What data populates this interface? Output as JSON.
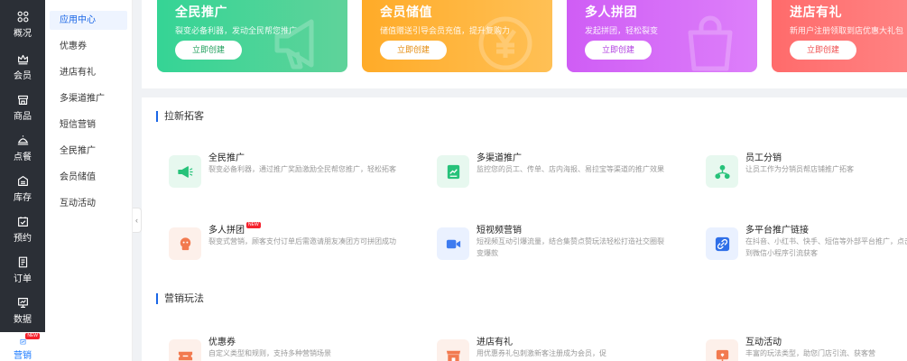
{
  "nav": {
    "items": [
      {
        "label": "概况",
        "icon": "grid-icon"
      },
      {
        "label": "会员",
        "icon": "crown-icon"
      },
      {
        "label": "商品",
        "icon": "shop-icon"
      },
      {
        "label": "点餐",
        "icon": "dish-icon"
      },
      {
        "label": "库存",
        "icon": "inventory-icon"
      },
      {
        "label": "预约",
        "icon": "calendar-check-icon"
      },
      {
        "label": "订单",
        "icon": "order-icon"
      },
      {
        "label": "数据",
        "icon": "data-icon"
      },
      {
        "label": "营销",
        "icon": "marketing-icon",
        "badge": "NEW"
      }
    ]
  },
  "submenu": {
    "items": [
      "应用中心",
      "优惠券",
      "进店有礼",
      "多渠道推广",
      "短信营销",
      "全民推广",
      "会员储值",
      "互动活动"
    ],
    "active": "应用中心"
  },
  "collapse_glyph": "‹",
  "banners": [
    {
      "title": "全民推广",
      "desc": "裂变必备利器，发动全民帮您推广",
      "button": "立即创建",
      "color": "#35d495"
    },
    {
      "title": "会员储值",
      "desc": "储值赠送引导会员充值，提升复购力",
      "button": "立即创建",
      "color": "#ffab28"
    },
    {
      "title": "多人拼团",
      "desc": "发起拼团，轻松裂变",
      "button": "立即创建",
      "color": "#cf5df5"
    },
    {
      "title": "进店有礼",
      "desc": "新用户注册领取到店优惠大礼包",
      "button": "立即创建",
      "color": "#ff6b6b"
    }
  ],
  "sections": [
    {
      "title": "拉新拓客",
      "cards": [
        {
          "title": "全民推广",
          "desc": "裂变必备利器，通过推广奖励激励全民帮您推广，轻松拓客",
          "icon": "megaphone-icon",
          "bg": "#e7f8ef",
          "fg": "#27c27a"
        },
        {
          "title": "多渠道推广",
          "desc": "监控您的员工、传单、店内海报、易拉宝等渠道的推广效果",
          "icon": "chart-board-icon",
          "bg": "#e7f8ef",
          "fg": "#27c27a"
        },
        {
          "title": "员工分销",
          "desc": "让员工作为分销员帮店铺推广拓客",
          "icon": "network-icon",
          "bg": "#e7f8ef",
          "fg": "#27c27a"
        },
        {
          "title": "多人拼团",
          "badge": "NEW",
          "desc": "裂变式营销，顾客支付订单后需邀请朋友凑团方可拼团成功",
          "icon": "group-buy-icon",
          "bg": "#fdf0ea",
          "fg": "#f27a4f"
        },
        {
          "title": "短视频营销",
          "desc": "短视频互动引爆流量，结合集赞点赞玩法轻松打造社交圈裂变爆款",
          "icon": "video-camera-icon",
          "bg": "#eaf1ff",
          "fg": "#3d7bf0"
        },
        {
          "title": "多平台推广链接",
          "desc": "在抖音、小红书、快手、短信等外部平台推广，点击后跳转到微信小程序引流获客",
          "icon": "link-icon",
          "bg": "#eaf1ff",
          "fg": "#2f6fe8"
        }
      ]
    },
    {
      "title": "营销玩法",
      "cards": [
        {
          "title": "优惠券",
          "desc": "自定义类型和规则，支持多种营销场景",
          "icon": "coupon-icon",
          "bg": "#fdf0ea",
          "fg": "#f27a4f"
        },
        {
          "title": "进店有礼",
          "desc": "用优惠券礼包刺激新客注册成为会员，促",
          "icon": "store-gift-icon",
          "bg": "#fdf0ea",
          "fg": "#f27a4f"
        },
        {
          "title": "互动活动",
          "desc": "丰富的玩法类型，助您门店引流、获客营",
          "icon": "interactive-icon",
          "bg": "#fdf0ea",
          "fg": "#f27a4f"
        }
      ]
    }
  ]
}
